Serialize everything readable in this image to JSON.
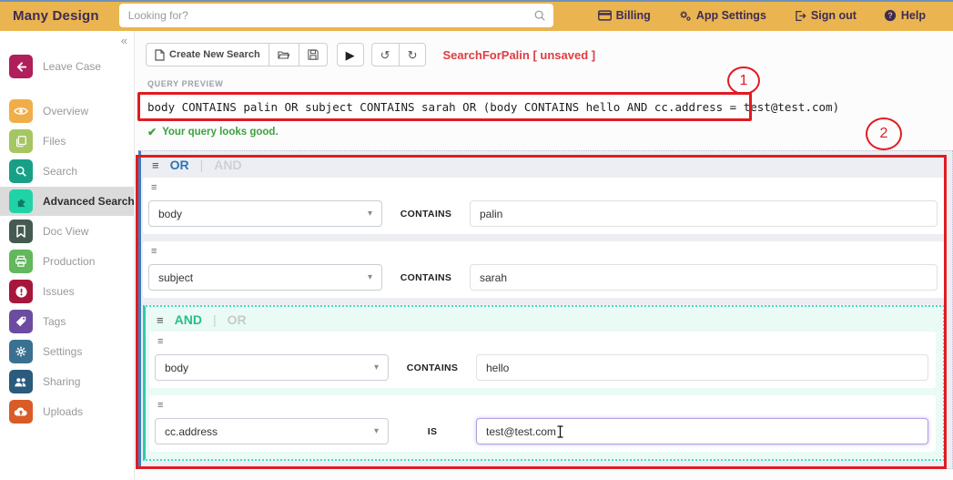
{
  "topbar": {
    "brand": "Many Design",
    "search_placeholder": "Looking for?",
    "nav": [
      {
        "label": "Billing",
        "icon": "credit-card-icon"
      },
      {
        "label": "App Settings",
        "icon": "gears-icon"
      },
      {
        "label": "Sign out",
        "icon": "sign-out-icon"
      },
      {
        "label": "Help",
        "icon": "help-icon"
      }
    ]
  },
  "sidebar": {
    "collapse": "«",
    "leave_case": {
      "label": "Leave Case",
      "color": "#B01E5B",
      "icon": "arrow-left-icon"
    },
    "items": [
      {
        "label": "Overview",
        "color": "#F0AE4B",
        "icon": "eye-icon",
        "active": false
      },
      {
        "label": "Files",
        "color": "#A5C661",
        "icon": "copy-icon",
        "active": false
      },
      {
        "label": "Search",
        "color": "#17A086",
        "icon": "magnifier-icon",
        "active": false
      },
      {
        "label": "Advanced Search",
        "color": "#1FD3A7",
        "icon": "puzzle-icon",
        "active": true
      },
      {
        "label": "Doc View",
        "color": "#455B51",
        "icon": "bookmark-icon",
        "active": false
      },
      {
        "label": "Production",
        "color": "#63B75D",
        "icon": "printer-icon",
        "active": false
      },
      {
        "label": "Issues",
        "color": "#A6173C",
        "icon": "exclamation-icon",
        "active": false
      },
      {
        "label": "Tags",
        "color": "#6C4CA0",
        "icon": "tag-icon",
        "active": false
      },
      {
        "label": "Settings",
        "color": "#3A7191",
        "icon": "gear-icon",
        "active": false
      },
      {
        "label": "Sharing",
        "color": "#2A5A7C",
        "icon": "users-icon",
        "active": false
      },
      {
        "label": "Uploads",
        "color": "#D95B27",
        "icon": "cloud-upload-icon",
        "active": false
      }
    ]
  },
  "toolbar": {
    "create_label": "Create New Search",
    "open_icon": "folder-open-icon",
    "save_icon": "save-icon",
    "play_icon": "▶",
    "undo_icon": "↺",
    "redo_icon": "↻",
    "title": "SearchForPalin [ unsaved ]"
  },
  "query": {
    "preview_label": "QUERY PREVIEW",
    "text": "body CONTAINS palin OR subject CONTAINS sarah OR (body CONTAINS hello AND cc.address = test@test.com)",
    "status_check": "✔",
    "status": "Your query looks good."
  },
  "builder": {
    "handle": "≡",
    "caret": "▾",
    "divider": "|",
    "or_group": {
      "active": "OR",
      "inactive": "AND"
    },
    "and_group": {
      "active": "AND",
      "inactive": "OR"
    },
    "rules": [
      {
        "field": "body",
        "operator": "CONTAINS",
        "value": "palin"
      },
      {
        "field": "subject",
        "operator": "CONTAINS",
        "value": "sarah"
      },
      {
        "field": "body",
        "operator": "CONTAINS",
        "value": "hello"
      },
      {
        "field": "cc.address",
        "operator": "IS",
        "value": "test@test.com",
        "focused": true
      }
    ]
  },
  "annotations": {
    "one": "1",
    "two": "2"
  },
  "colors": {
    "topbar_bg": "#EAB550",
    "brand_text": "#3E2C55",
    "annotation_red": "#E11B22",
    "or_blue": "#2E76B5",
    "and_teal": "#26BD8C",
    "success_green": "#3DA13D",
    "title_red": "#E03C40",
    "active_item_bg": "#DBDBDB"
  }
}
